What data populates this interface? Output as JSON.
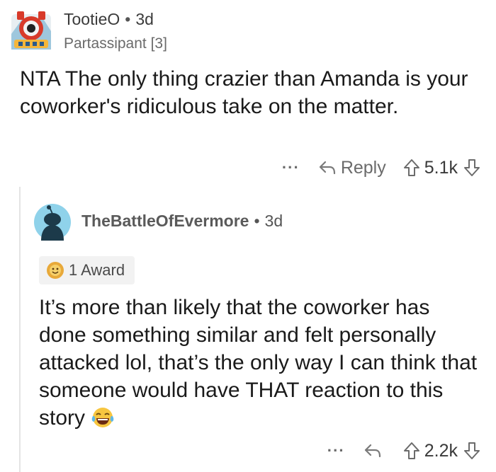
{
  "top_comment": {
    "username": "TootieO",
    "age": "3d",
    "flair": "Partassipant [3]",
    "body": "NTA The only thing crazier than Amanda is your coworker's ridiculous take on the matter.",
    "actions": {
      "more": "···",
      "reply_label": "Reply",
      "score": "5.1k"
    }
  },
  "reply_comment": {
    "username": "TheBattleOfEvermore",
    "age": "3d",
    "award_label": "1 Award",
    "body": "It’s more than likely that the coworker has done something similar and felt personally attacked lol, that’s the only way I can think that someone would have THAT reaction to this story",
    "actions": {
      "more": "···",
      "score": "2.2k"
    }
  },
  "separator": "•"
}
